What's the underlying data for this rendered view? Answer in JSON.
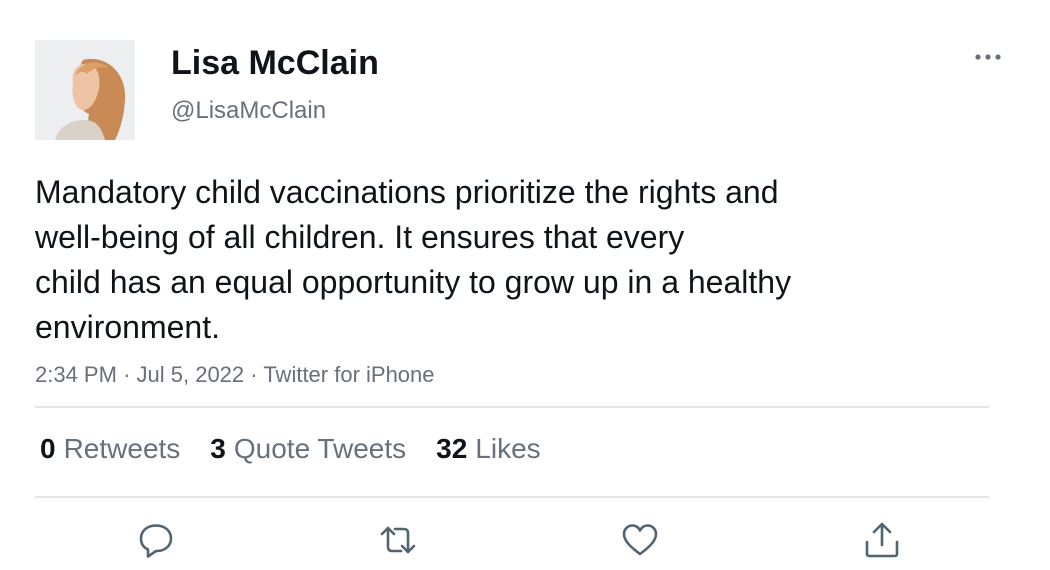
{
  "user": {
    "display_name": "Lisa McClain",
    "handle": "@LisaMcClain"
  },
  "tweet": {
    "lines": [
      "Mandatory child vaccinations prioritize the rights and",
      "well-being of all children. It ensures that every",
      "child has an equal opportunity to grow up in a healthy",
      "environment."
    ],
    "time": "2:34 PM",
    "date": "Jul 5, 2022",
    "source": "Twitter for iPhone",
    "separator": "·"
  },
  "stats": {
    "retweets_count": "0",
    "retweets_label": "Retweets",
    "quote_count": "3",
    "quote_label": "Quote Tweets",
    "likes_count": "32",
    "likes_label": "Likes"
  },
  "icons": {
    "more": "more-horizontal-icon",
    "reply": "reply-icon",
    "retweet": "retweet-icon",
    "like": "heart-icon",
    "share": "share-icon"
  },
  "colors": {
    "text": "#0f1419",
    "secondary": "#66717b",
    "divider": "#e3e6e8",
    "icon": "#536471"
  }
}
